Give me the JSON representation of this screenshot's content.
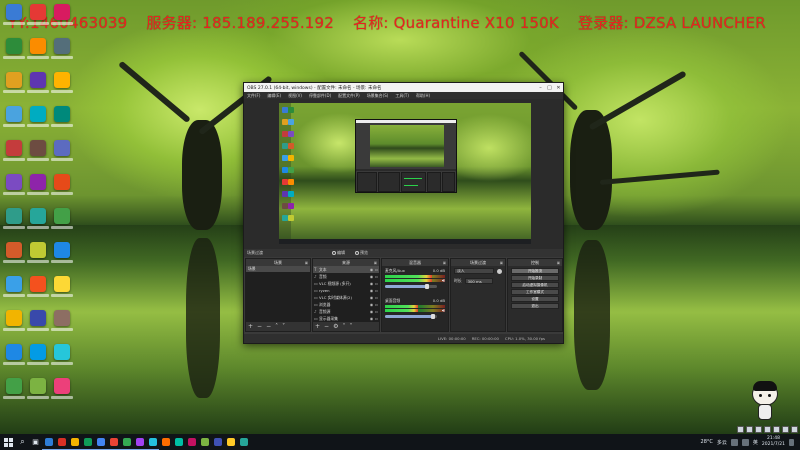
{
  "overlay": {
    "text_segments": [
      "YY:1460463039",
      "服务器: 185.189.255.192",
      "名称: Quarantine X10 150K",
      "登录器: DZSA LAUNCHER"
    ],
    "color": "#e8231f"
  },
  "desktop": {
    "icon_colors": [
      "#3a7bd5",
      "#2d8c3a",
      "#e0a020",
      "#4aa3df",
      "#c43c3c",
      "#7b4bc2",
      "#2f9c8a",
      "#d35b2a",
      "#3aa0e8",
      "#f2b400",
      "#1e88e5",
      "#43a047",
      "#e53935",
      "#fb8c00",
      "#5e35b1",
      "#00acc1",
      "#6d4c41",
      "#8e24aa",
      "#26a69a",
      "#c0ca33",
      "#f4511e",
      "#3949ab",
      "#039be5",
      "#7cb342",
      "#d81b60",
      "#546e7a",
      "#ffb300",
      "#00897b",
      "#5c6bc0",
      "#e64a19",
      "#43a047",
      "#1e88e5",
      "#fdd835",
      "#8d6e63",
      "#26c6da",
      "#ec407a"
    ]
  },
  "obs": {
    "title": "OBS 27.0.1 (64-bit, windows) - 配置文件: 未命名 - 场景: 未命名",
    "menu": [
      "文件(F)",
      "编辑(E)",
      "视图(V)",
      "停靠部件(D)",
      "配置文件(P)",
      "场景集合(S)",
      "工具(T)",
      "帮助(H)"
    ],
    "toggle": {
      "left": "场景过渡",
      "mode_a": "编辑",
      "mode_b": "预览"
    },
    "scenes": {
      "title": "场景",
      "items": [
        "场景"
      ]
    },
    "sources": {
      "title": "来源",
      "items": [
        {
          "icon": "T",
          "name": "文本"
        },
        {
          "icon": "♪",
          "name": "音频"
        },
        {
          "icon": "▭",
          "name": "VLC 视频源 (多开)"
        },
        {
          "icon": "▭",
          "name": "ryzen"
        },
        {
          "icon": "▭",
          "name": "VLC 实时媒体源(2)"
        },
        {
          "icon": "▭",
          "name": "浏览器"
        },
        {
          "icon": "♪",
          "name": "音频源"
        },
        {
          "icon": "▭",
          "name": "显示器采集"
        },
        {
          "icon": "▭",
          "name": "浏览器2"
        }
      ]
    },
    "mixer": {
      "title": "混音器",
      "channels": [
        {
          "name": "麦克风/Aux",
          "db": "0.0 dB",
          "level": 0.78,
          "volume": 0.8
        },
        {
          "name": "桌面音频",
          "db": "0.0 dB",
          "level": 0.55,
          "volume": 0.92
        }
      ]
    },
    "transitions": {
      "title": "场景过渡",
      "type": "淡入",
      "duration_label": "时长",
      "duration": "300 ms"
    },
    "controls": {
      "title": "控制",
      "buttons": [
        "开始推流",
        "开始录制",
        "启动虚拟摄像机",
        "工作室模式",
        "设置",
        "退出"
      ]
    },
    "status": [
      "LIVE: 00:00:00",
      "REC: 00:00:00",
      "CPU: 1.0%, 30.00 fps"
    ]
  },
  "taskbar": {
    "tray": {
      "temp": "28°C",
      "weather": "多云",
      "lang": "英",
      "time": "21:48",
      "date": "2021/7/21"
    },
    "app_colors": [
      "#2e7dd7",
      "#d93025",
      "#f4b400",
      "#0f9d58",
      "#4285f4",
      "#ea4335",
      "#34a853",
      "#a142f4",
      "#24c1e0",
      "#ff6d00",
      "#00bfa5",
      "#c51162",
      "#7cb342",
      "#3f51b5",
      "#ffca28",
      "#26a69a"
    ]
  }
}
